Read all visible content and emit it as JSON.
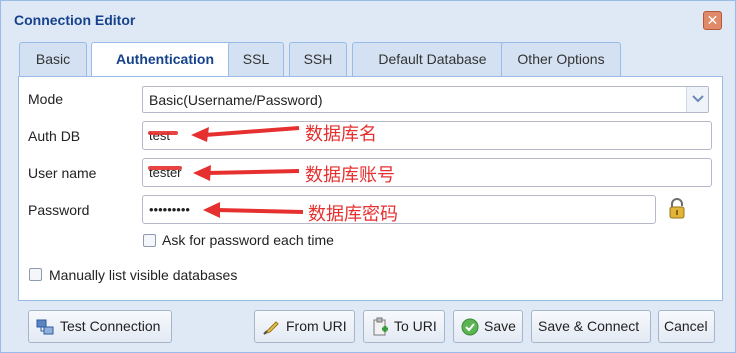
{
  "window": {
    "title": "Connection Editor",
    "close_glyph": "✕"
  },
  "tabs": [
    {
      "label": "Basic"
    },
    {
      "label": "Authentication"
    },
    {
      "label": "SSL"
    },
    {
      "label": "SSH"
    },
    {
      "label": "Default Database"
    },
    {
      "label": "Other Options"
    }
  ],
  "form": {
    "mode_label": "Mode",
    "mode_value": "Basic(Username/Password)",
    "auth_db_label": "Auth DB",
    "auth_db_value": "test",
    "username_label": "User name",
    "username_value": "tester",
    "password_label": "Password",
    "password_value": "•••••••••",
    "ask_password_label": "Ask for password each time",
    "manual_db_label": "Manually list visible databases"
  },
  "annotations": {
    "auth_db_note": "数据库名",
    "username_note": "数据库账号",
    "password_note": "数据库密码",
    "color": "#e63030"
  },
  "buttons": {
    "test_connection": "Test Connection",
    "from_uri": "From URI",
    "to_uri": "To URI",
    "save": "Save",
    "save_connect": "Save & Connect",
    "cancel": "Cancel"
  },
  "colors": {
    "title": "#15428b",
    "window_bg": "#dfe9f5",
    "border": "#99bbe8"
  }
}
